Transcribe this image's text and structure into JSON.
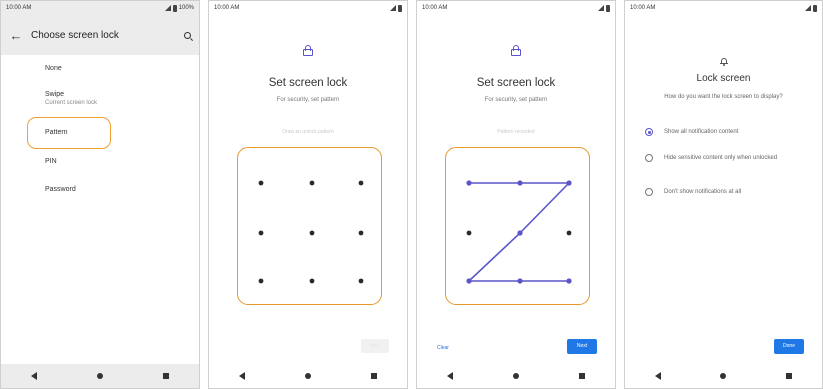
{
  "status": {
    "time": "10:00 AM",
    "battery": "100%"
  },
  "screen1": {
    "title": "Choose screen lock",
    "options": [
      {
        "label": "None",
        "sub": ""
      },
      {
        "label": "Swipe",
        "sub": "Current screen lock"
      },
      {
        "label": "Pattern",
        "sub": ""
      },
      {
        "label": "PIN",
        "sub": ""
      },
      {
        "label": "Password",
        "sub": ""
      }
    ],
    "highlighted": "Pattern"
  },
  "screen2": {
    "title": "Set screen lock",
    "subtitle": "For security, set pattern",
    "hint": "Draw an unlock pattern",
    "button": "Next"
  },
  "screen3": {
    "title": "Set screen lock",
    "subtitle": "For security, set pattern",
    "hint": "Pattern recorded",
    "clear_label": "Clear",
    "next_label": "Next",
    "pattern_sequence": [
      1,
      2,
      3,
      5,
      7,
      8,
      9
    ]
  },
  "screen4": {
    "title": "Lock screen",
    "subtitle": "How do you want the lock screen to display?",
    "options": [
      {
        "label": "Show all notification content",
        "selected": true
      },
      {
        "label": "Hide sensitive content only when unlocked",
        "selected": false
      },
      {
        "label": "Don't show notifications at all",
        "selected": false
      }
    ],
    "button": "Done"
  },
  "colors": {
    "accent": "#5a55c9",
    "highlight": "#e8972a",
    "button": "#1f78e6"
  }
}
